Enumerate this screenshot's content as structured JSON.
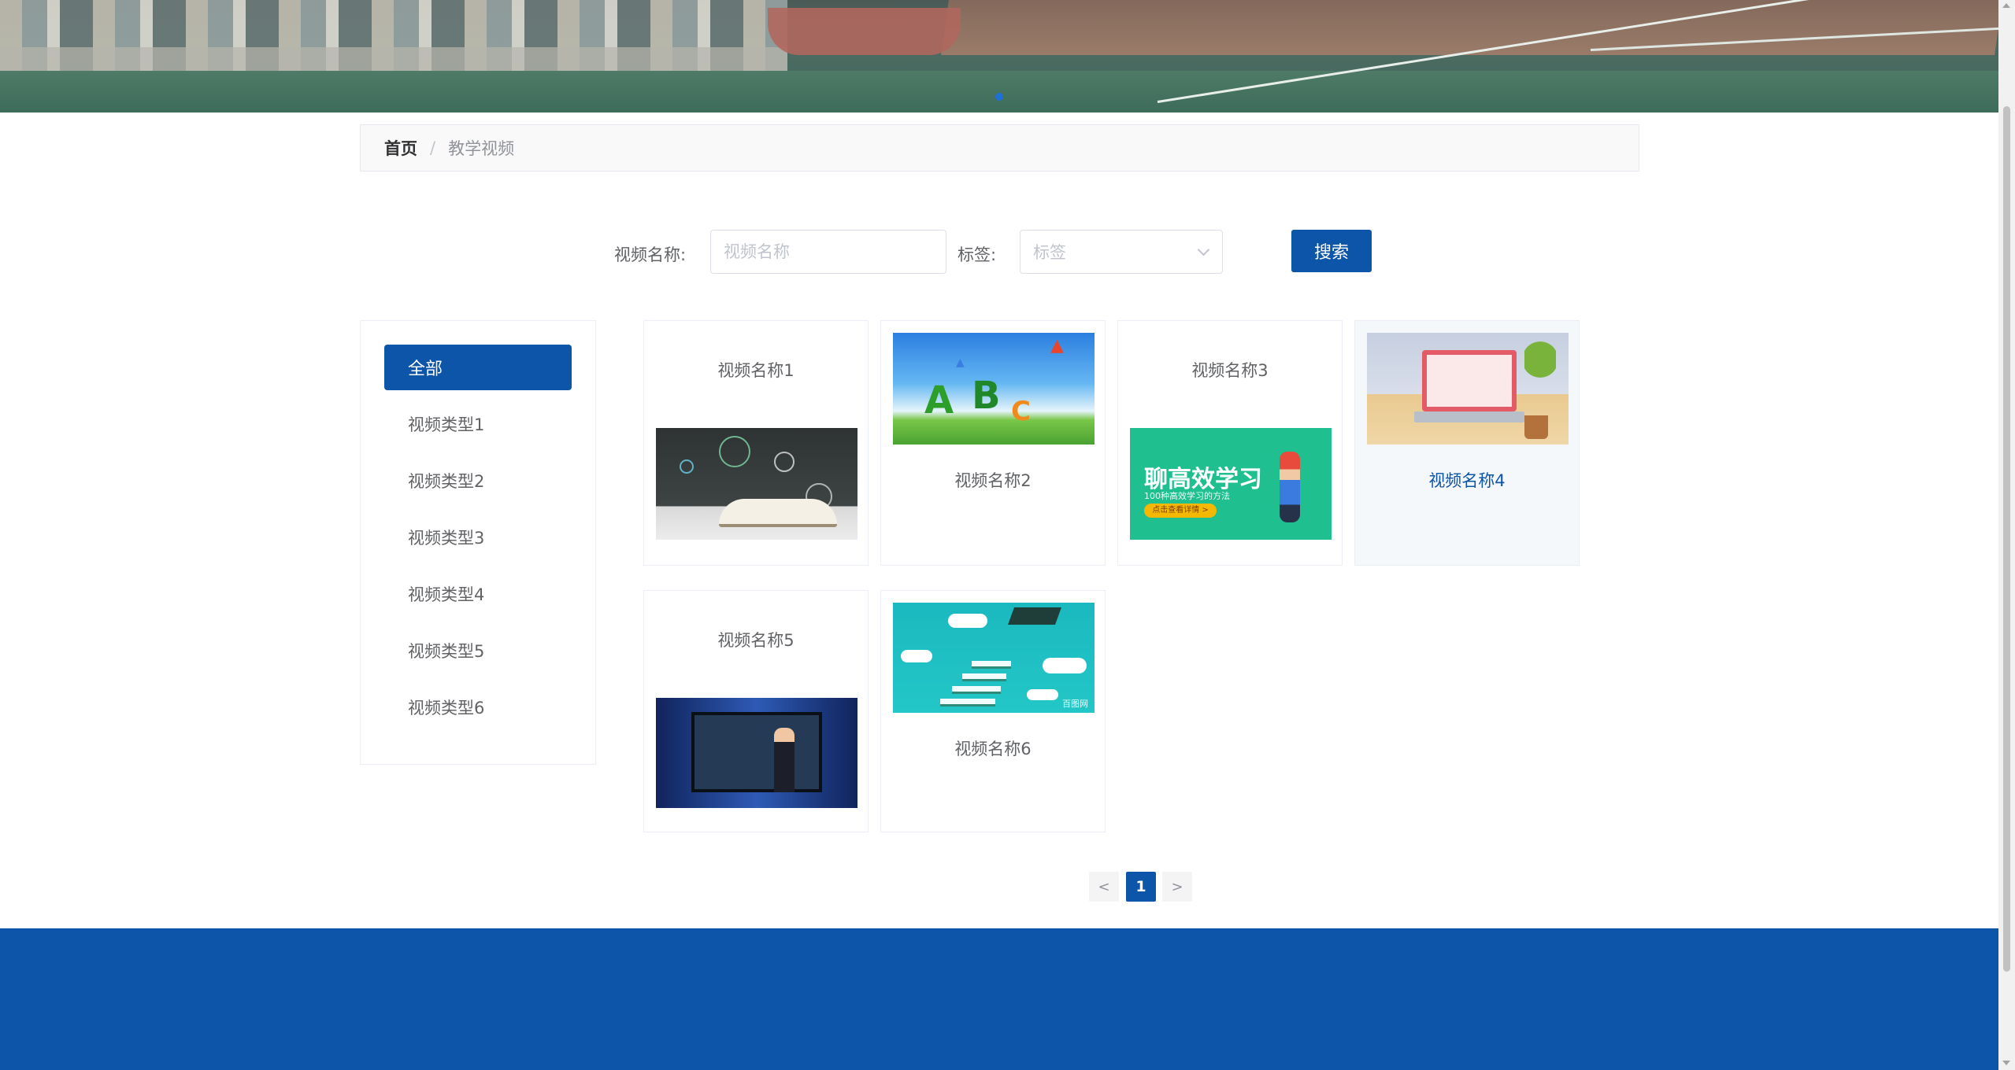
{
  "breadcrumb": {
    "home": "首页",
    "separator": "/",
    "current": "教学视频"
  },
  "search": {
    "name_label": "视频名称:",
    "name_placeholder": "视频名称",
    "tag_label": "标签:",
    "tag_placeholder": "标签",
    "button_label": "搜索"
  },
  "sidebar": {
    "items": [
      {
        "label": "全部",
        "active": true
      },
      {
        "label": "视频类型1"
      },
      {
        "label": "视频类型2"
      },
      {
        "label": "视频类型3"
      },
      {
        "label": "视频类型4"
      },
      {
        "label": "视频类型5"
      },
      {
        "label": "视频类型6"
      }
    ]
  },
  "videos": [
    {
      "title": "视频名称1",
      "image": "chalkboard-book"
    },
    {
      "title": "视频名称2",
      "image": "abc-book"
    },
    {
      "title": "视频名称3",
      "image": "study-poster",
      "image_text": "聊高效学习",
      "image_subtext": "100种高效学习的方法",
      "image_button": "点击查看详情 >"
    },
    {
      "title": "视频名称4",
      "image": "online-teacher-desk",
      "hovered": true
    },
    {
      "title": "视频名称5",
      "image": "presenter-screen"
    },
    {
      "title": "视频名称6",
      "image": "stairs-graduation",
      "image_watermark": "百图网"
    }
  ],
  "pagination": {
    "prev": "<",
    "current": "1",
    "next": ">"
  },
  "colors": {
    "primary": "#0d55a8",
    "border": "#ebeef5",
    "text": "#606266",
    "placeholder": "#c0c4cc"
  }
}
